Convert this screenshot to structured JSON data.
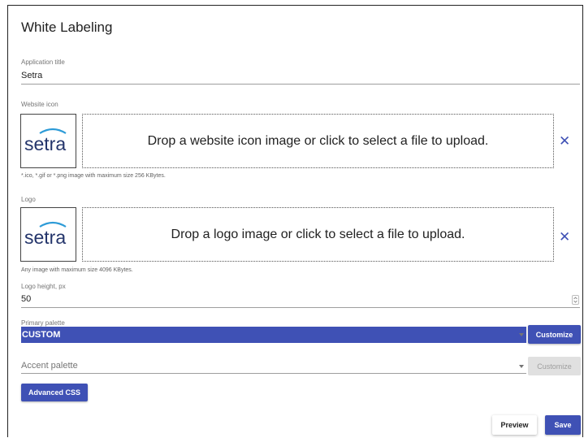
{
  "page": {
    "title": "White Labeling"
  },
  "app_title": {
    "label": "Application title",
    "value": "Setra"
  },
  "website_icon": {
    "label": "Website icon",
    "logo_text": "setra",
    "drop_text": "Drop a website icon image or click to select a file to upload.",
    "hint": "*.ico, *.gif or *.png image with maximum size 256 KBytes.",
    "clear_symbol": "✕"
  },
  "logo": {
    "label": "Logo",
    "logo_text": "setra",
    "drop_text": "Drop a logo image or click to select a file to upload.",
    "hint": "Any image with maximum size 4096 KBytes.",
    "clear_symbol": "✕"
  },
  "logo_height": {
    "label": "Logo height, px",
    "value": "50"
  },
  "primary_palette": {
    "label": "Primary palette",
    "value": "CUSTOM",
    "button": "Customize"
  },
  "accent_palette": {
    "placeholder": "Accent palette",
    "button": "Customize"
  },
  "advanced_css": {
    "label": "Advanced CSS"
  },
  "footer": {
    "preview": "Preview",
    "save": "Save"
  },
  "colors": {
    "primary": "#3f51b5",
    "brand_navy": "#24356b",
    "brand_blue": "#2d9bd7"
  }
}
